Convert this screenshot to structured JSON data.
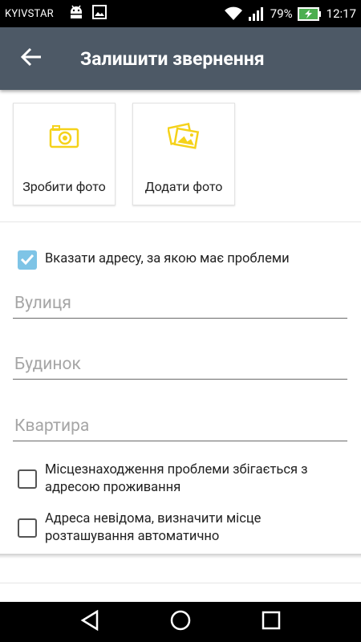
{
  "status_bar": {
    "carrier": "KYIVSTAR",
    "battery_percent": "79%",
    "time": "12:17"
  },
  "app_bar": {
    "title": "Залишити звернення"
  },
  "photo_actions": {
    "take_photo": "Зробити фото",
    "add_photo": "Додати фото"
  },
  "address": {
    "specify_address_label": "Вказати адресу, за якою має проблеми",
    "specify_address_checked": true,
    "street_placeholder": "Вулиця",
    "house_placeholder": "Будинок",
    "apartment_placeholder": "Квартира",
    "same_as_residence_label": "Місцезнаходження проблеми збігається з адресою проживання",
    "same_as_residence_checked": false,
    "unknown_address_label": "Адреса невідома, визначити місце розташування автоматично",
    "unknown_address_checked": false
  },
  "colors": {
    "app_bar": "#4d5966",
    "accent_icon": "#f5d21a",
    "checkbox_checked": "#7ec4e6"
  },
  "icons": {
    "back": "arrow-left-icon",
    "camera": "camera-icon",
    "gallery": "images-icon",
    "nav_back": "triangle-back-icon",
    "nav_home": "circle-home-icon",
    "nav_recents": "square-recents-icon"
  }
}
